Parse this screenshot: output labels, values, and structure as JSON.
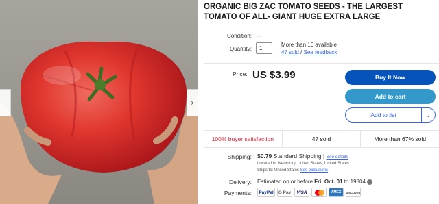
{
  "listing": {
    "title": "ORGANIC BIG ZAC TOMATO SEEDS - THE LARGEST TOMATO OF ALL- GIANT HUGE EXTRA LARGE"
  },
  "gallery": {
    "prev_icon": "chevron-left-icon",
    "next_icon": "chevron-right-icon",
    "next_glyph": "›"
  },
  "condition": {
    "label": "Condition:",
    "value": "--"
  },
  "quantity": {
    "label": "Quantity:",
    "value": "1",
    "availability": "More than 10 available",
    "sold_link": "47 sold",
    "separator": "/",
    "feedback_link": "See feedback"
  },
  "price": {
    "label": "Price:",
    "value": "US $3.99"
  },
  "buttons": {
    "buy_now": "Buy It Now",
    "add_to_cart": "Add to cart",
    "add_to_list": "Add to list",
    "dropdown_glyph": "⌄"
  },
  "stats": {
    "satisfaction": "100% buyer satisfaction",
    "sold": "47 sold",
    "watchers": "More than 67% sold"
  },
  "shipping": {
    "label": "Shipping:",
    "cost": "$0.79",
    "method": "Standard Shipping |",
    "details_link": "See details",
    "location": "Located in:  Kentucky, United States, United States",
    "ships_to_prefix": "Ships to:  United States",
    "exclusions_link": "See exclusions"
  },
  "delivery": {
    "label": "Delivery:",
    "prefix": "Estimated on or before",
    "date": "Fri. Oct. 01",
    "suffix": "to 19804"
  },
  "payments": {
    "label": "Payments:",
    "methods": [
      "PayPal",
      "G Pay",
      "VISA",
      "MC",
      "AMEX",
      "DISCOVER"
    ]
  },
  "colors": {
    "accent_blue": "#3665f3",
    "buy_now_bg": "#0654ba",
    "cart_bg": "#3498ca",
    "satisfaction_red": "#dd1e31"
  }
}
